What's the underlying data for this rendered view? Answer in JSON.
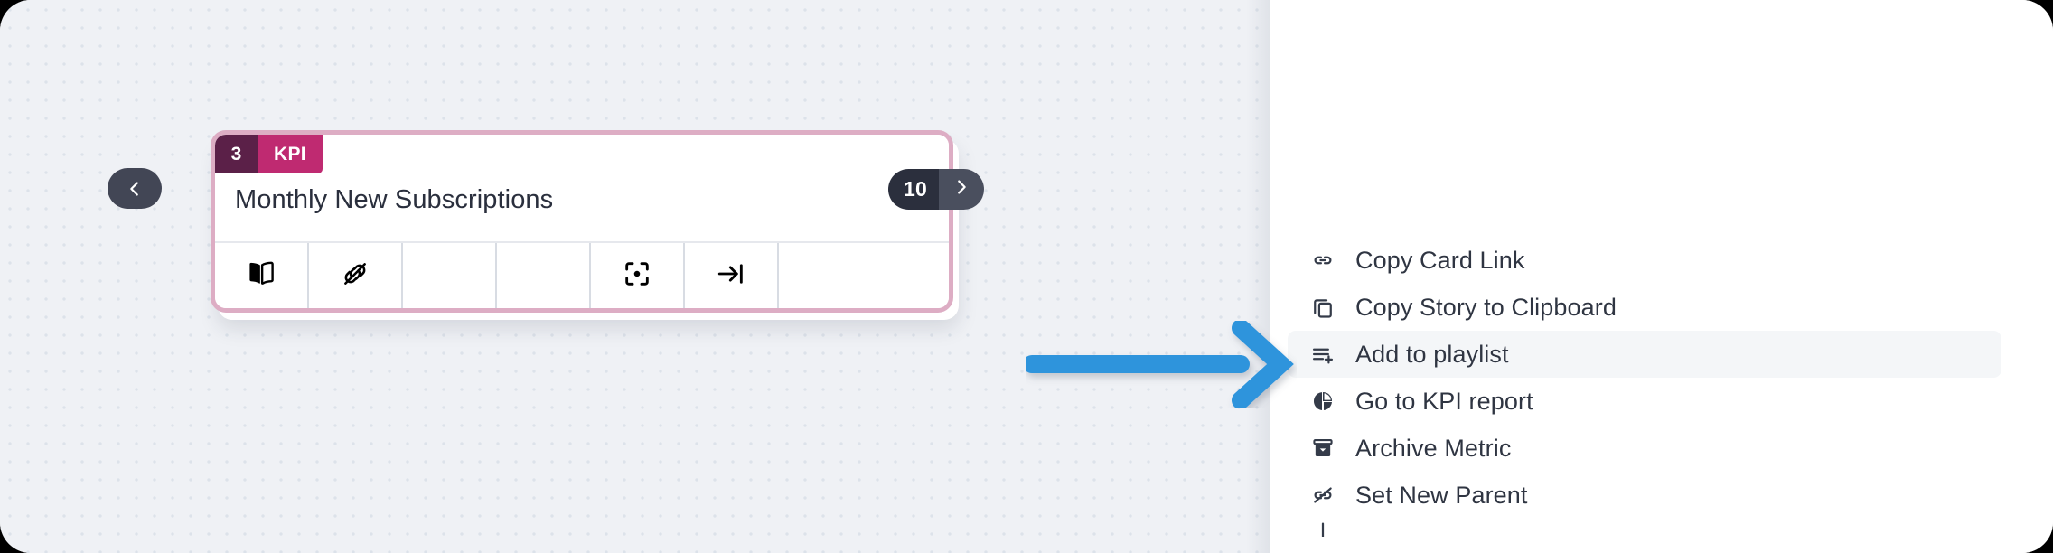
{
  "canvas": {
    "nav_prev": {
      "icon": "chevron-left-icon"
    },
    "pager": {
      "count": "10",
      "next_icon": "chevron-right-icon"
    },
    "card": {
      "badge_number": "3",
      "badge_type": "KPI",
      "title": "Monthly New Subscriptions",
      "toolbar": [
        {
          "icon": "open-book-icon",
          "name": "open-book"
        },
        {
          "icon": "link-off-icon",
          "name": "link-off"
        },
        {
          "icon": "",
          "name": "empty-1"
        },
        {
          "icon": "",
          "name": "empty-2"
        },
        {
          "icon": "focus-target-icon",
          "name": "focus-target"
        },
        {
          "icon": "arrow-to-line-icon",
          "name": "arrow-to-line"
        },
        {
          "icon": "",
          "name": "empty-3"
        }
      ]
    }
  },
  "annotation": {
    "arrow_color": "#2e94dc",
    "points_to": "Add to playlist"
  },
  "menu": {
    "items": [
      {
        "label": "Copy Card Link",
        "icon": "link-icon",
        "highlighted": false
      },
      {
        "label": "Copy Story to Clipboard",
        "icon": "copy-icon",
        "highlighted": false
      },
      {
        "label": "Add to playlist",
        "icon": "playlist-add-icon",
        "highlighted": true
      },
      {
        "label": "Go to KPI report",
        "icon": "pie-chart-icon",
        "highlighted": false
      },
      {
        "label": "Archive Metric",
        "icon": "archive-icon",
        "highlighted": false
      },
      {
        "label": "Set New Parent",
        "icon": "link-off-icon",
        "highlighted": false
      }
    ]
  },
  "colors": {
    "badge_number_bg": "#5b2048",
    "badge_type_bg": "#bf2a71",
    "card_border": "#ddadc4",
    "pager_bg": "#2b2f3d",
    "pager_next_bg": "#4a4f5e",
    "nav_bg": "#424655",
    "canvas_bg": "#eff1f5",
    "menu_highlight": "#f4f6f8",
    "text": "#2f3542"
  }
}
